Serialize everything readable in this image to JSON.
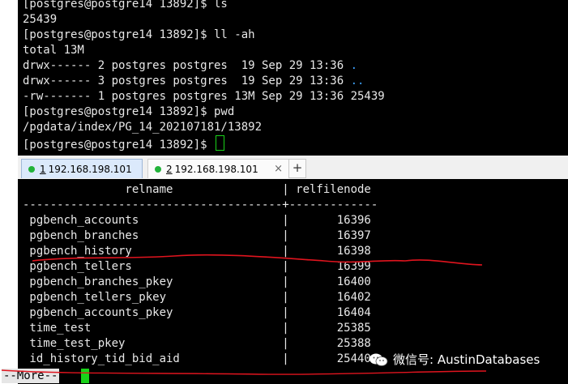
{
  "top_terminal": {
    "lines": [
      "[postgres@postgre14 13892]$ ls",
      "25439",
      "[postgres@postgre14 13892]$ ll -ah",
      "total 13M",
      "drwx------ 2 postgres postgres  19 Sep 29 13:36 ",
      "drwx------ 3 postgres postgres  19 Sep 29 13:36 ",
      "-rw------- 1 postgres postgres 13M Sep 29 13:36 25439",
      "[postgres@postgre14 13892]$ pwd",
      "/pgdata/index/PG_14_202107181/13892",
      "[postgres@postgre14 13892]$ "
    ],
    "dir_dot": ".",
    "dir_dotdot": ".."
  },
  "tabs": [
    {
      "num": "1",
      "label": "192.168.198.101"
    },
    {
      "num": "2",
      "label": "192.168.198.101"
    }
  ],
  "tab_close": "×",
  "tab_add": "+",
  "bottom_terminal": {
    "header": "               relname                | relfilenode",
    "separator": "--------------------------------------+-------------",
    "rows": [
      " pgbench_accounts                     |       16396",
      " pgbench_branches                     |       16397",
      " pgbench_history                      |       16398",
      " pgbench_tellers                      |       16399",
      " pgbench_branches_pkey                |       16400",
      " pgbench_tellers_pkey                 |       16402",
      " pgbench_accounts_pkey                |       16404",
      " time_test                            |       25385",
      " time_test_pkey                       |       25388",
      " id_history_tid_bid_aid               |       25440"
    ]
  },
  "pager": "--More--",
  "watermark": "微信号: AustinDatabases",
  "colors": {
    "terminal_bg": "#000000",
    "cursor": "#19d219",
    "annotation": "#e0141e",
    "dir_color": "#3ca0ff"
  }
}
